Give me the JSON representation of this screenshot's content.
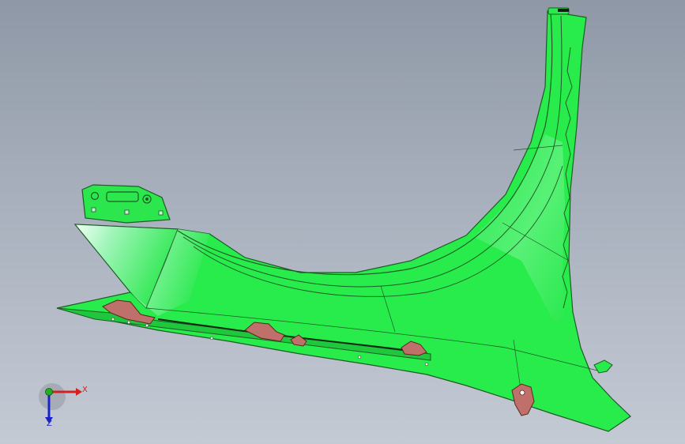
{
  "scene": {
    "background_top": "#8f98a6",
    "background_bottom": "#c4cad4",
    "part_color": "#22ee44",
    "part_highlight": "#e8fff0",
    "edge_color": "#1a5a22",
    "bracket_color": "#c0706a"
  },
  "triad": {
    "x_label": "X",
    "z_label": "Z",
    "x_color": "#d42020",
    "y_color": "#20b020",
    "z_color": "#1a22c8"
  }
}
